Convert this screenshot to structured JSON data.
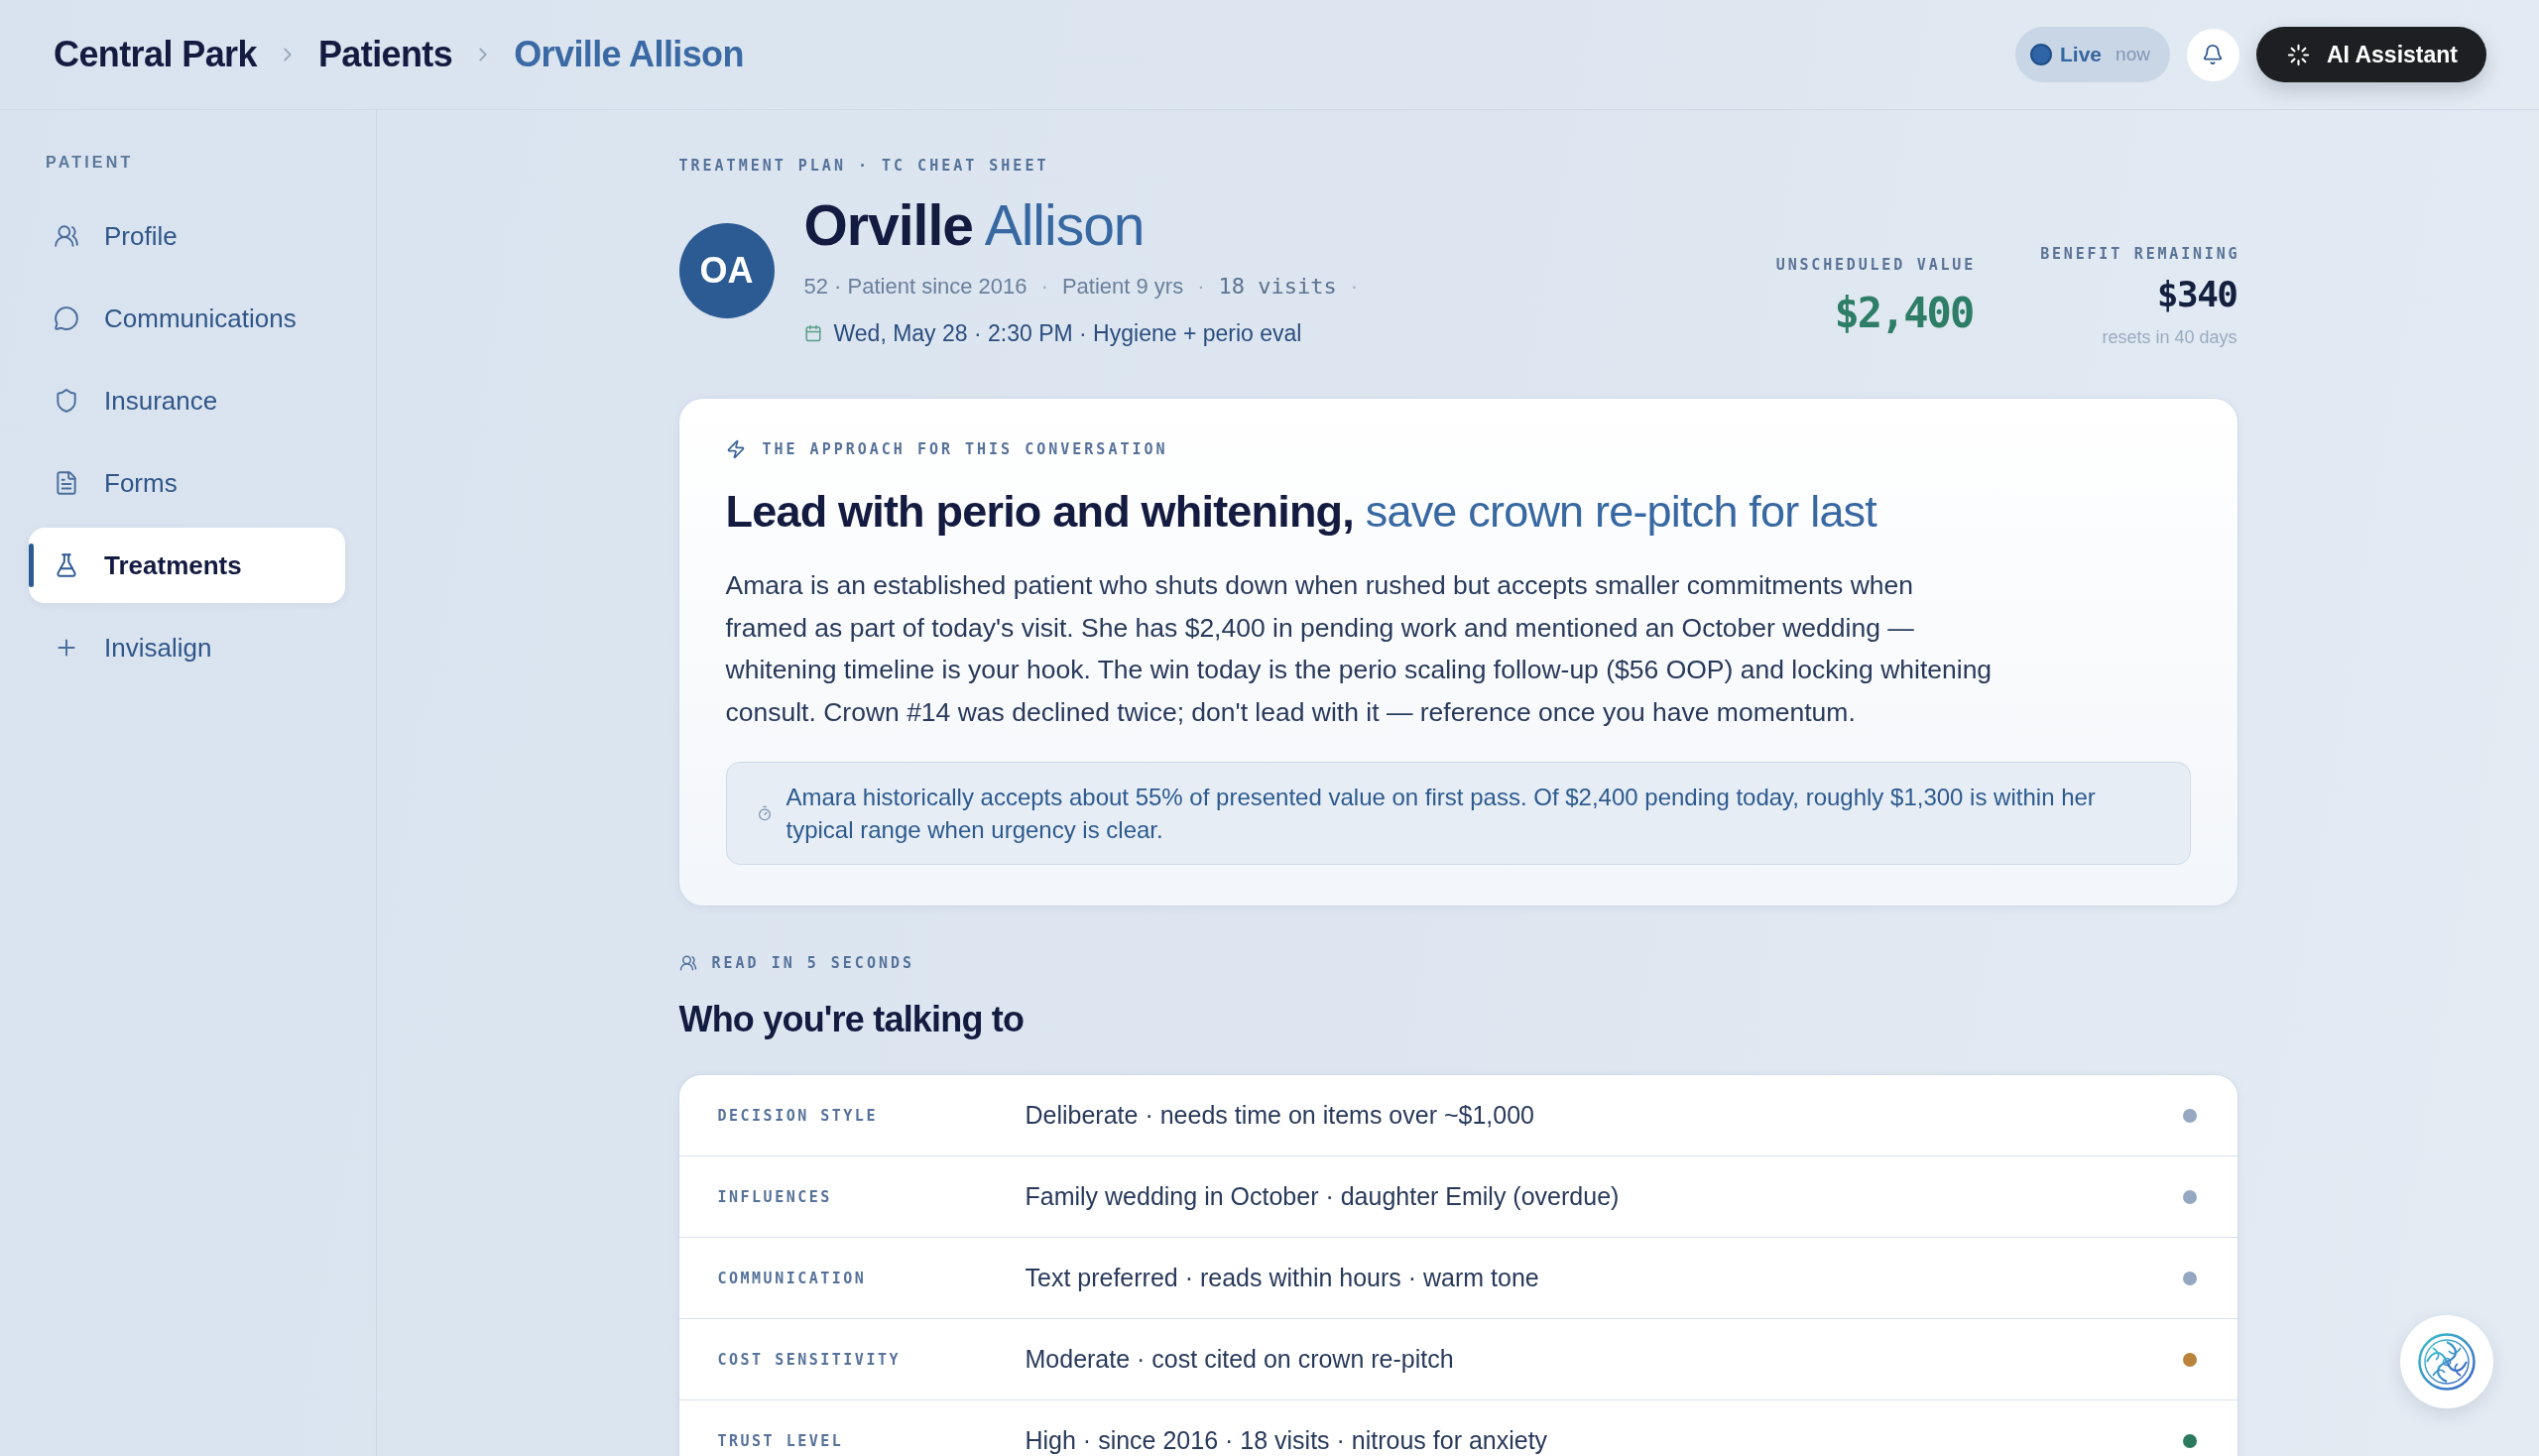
{
  "breadcrumb": [
    {
      "label": "Central Park",
      "current": false
    },
    {
      "label": "Patients",
      "current": false
    },
    {
      "label": "Orville Allison",
      "current": true
    }
  ],
  "header_actions": {
    "live": {
      "label": "Live",
      "time": "now"
    },
    "assistant_button": {
      "label": "AI Assistant"
    }
  },
  "sidebar": {
    "heading": "PATIENT",
    "items": [
      {
        "label": "Profile",
        "selected": false
      },
      {
        "label": "Communications",
        "selected": false
      },
      {
        "label": "Insurance",
        "selected": false
      },
      {
        "label": "Forms",
        "selected": false
      },
      {
        "label": "Treatments",
        "selected": true
      },
      {
        "label": "Invisalign",
        "selected": false
      }
    ]
  },
  "plan_header": {
    "eyebrow": "TREATMENT PLAN · TC CHEAT SHEET",
    "initials": "OA",
    "name": "**Orville** Allison",
    "meta": [
      {
        "kind": "text",
        "text": "52 · Patient since 2016"
      },
      {
        "kind": "separator",
        "text": "·"
      },
      {
        "kind": "text",
        "text": "Patient 9 yrs"
      },
      {
        "kind": "separator",
        "text": "·"
      },
      {
        "kind": "count",
        "text": "18 visits"
      },
      {
        "kind": "separator",
        "text": "·"
      }
    ],
    "appointment": "Wed, May 28 · 2:30 PM · Hygiene + perio eval",
    "stats": [
      {
        "kind": "highlight",
        "label": "UNSCHEDULED VALUE",
        "value": "$2,400"
      },
      {
        "kind": "balance",
        "label": "BENEFIT REMAINING",
        "value": "$340",
        "note": "resets in 40 days"
      }
    ]
  },
  "approach": {
    "eyebrow": "THE APPROACH FOR THIS CONVERSATION",
    "title": "**Lead with perio and whitening,** save crown re-pitch for last",
    "body": "Amara is an established patient who shuts down when rushed but accepts smaller commitments when framed as part of today's visit. She has $2,400 in pending work and mentioned an October wedding — whitening timeline is your hook. The win today is the perio scaling follow-up ($56 OOP) and locking whitening consult. Crown #14 was declined twice; don't lead with it — reference once you have momentum.",
    "insight": "Amara historically accepts about 55% of presented value on first pass. Of $2,400 pending today, roughly $1,300 is within her typical range when urgency is clear."
  },
  "profile": {
    "eyebrow": "READ IN 5 SECONDS",
    "title": "Who you're talking to",
    "rows": [
      {
        "label": "DECISION STYLE",
        "value": "Deliberate · needs time on items over ~$1,000",
        "color": "#95a7c1"
      },
      {
        "label": "INFLUENCES",
        "value": "Family wedding in October · daughter Emily (overdue)",
        "color": "#95a7c1"
      },
      {
        "label": "COMMUNICATION",
        "value": "Text preferred · reads within hours · warm tone",
        "color": "#95a7c1"
      },
      {
        "label": "COST SENSITIVITY",
        "value": "Moderate · cost cited on crown re-pitch",
        "color": "#b9833b"
      },
      {
        "label": "TRUST LEVEL",
        "value": "High · since 2016 · 18 visits · nitrous for anxiety",
        "color": "#2b7a5e"
      }
    ]
  }
}
